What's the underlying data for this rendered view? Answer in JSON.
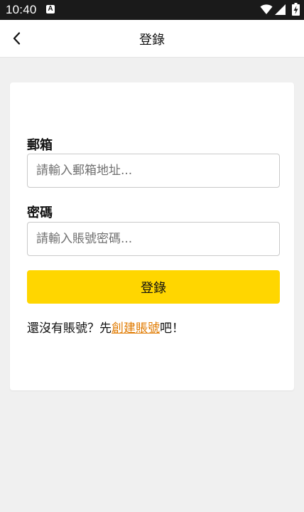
{
  "status_bar": {
    "time": "10:40",
    "notification_icon": "a-badge-icon",
    "icons": [
      "wifi-icon",
      "cell-signal-icon",
      "battery-charging-icon"
    ]
  },
  "app_bar": {
    "title": "登錄",
    "back_icon": "chevron-left-icon"
  },
  "form": {
    "email": {
      "label": "郵箱",
      "value": "",
      "placeholder": "請輸入郵箱地址..."
    },
    "password": {
      "label": "密碼",
      "value": "",
      "placeholder": "請輸入賬號密碼..."
    },
    "submit_label": "登錄",
    "signup": {
      "prefix": "還沒有賬號？先",
      "link": "創建賬號",
      "suffix": "吧！"
    }
  },
  "colors": {
    "primary_button": "#ffd600",
    "link": "#e07a00",
    "background": "#f0f0f0",
    "status_bar": "#1a1a1a"
  }
}
